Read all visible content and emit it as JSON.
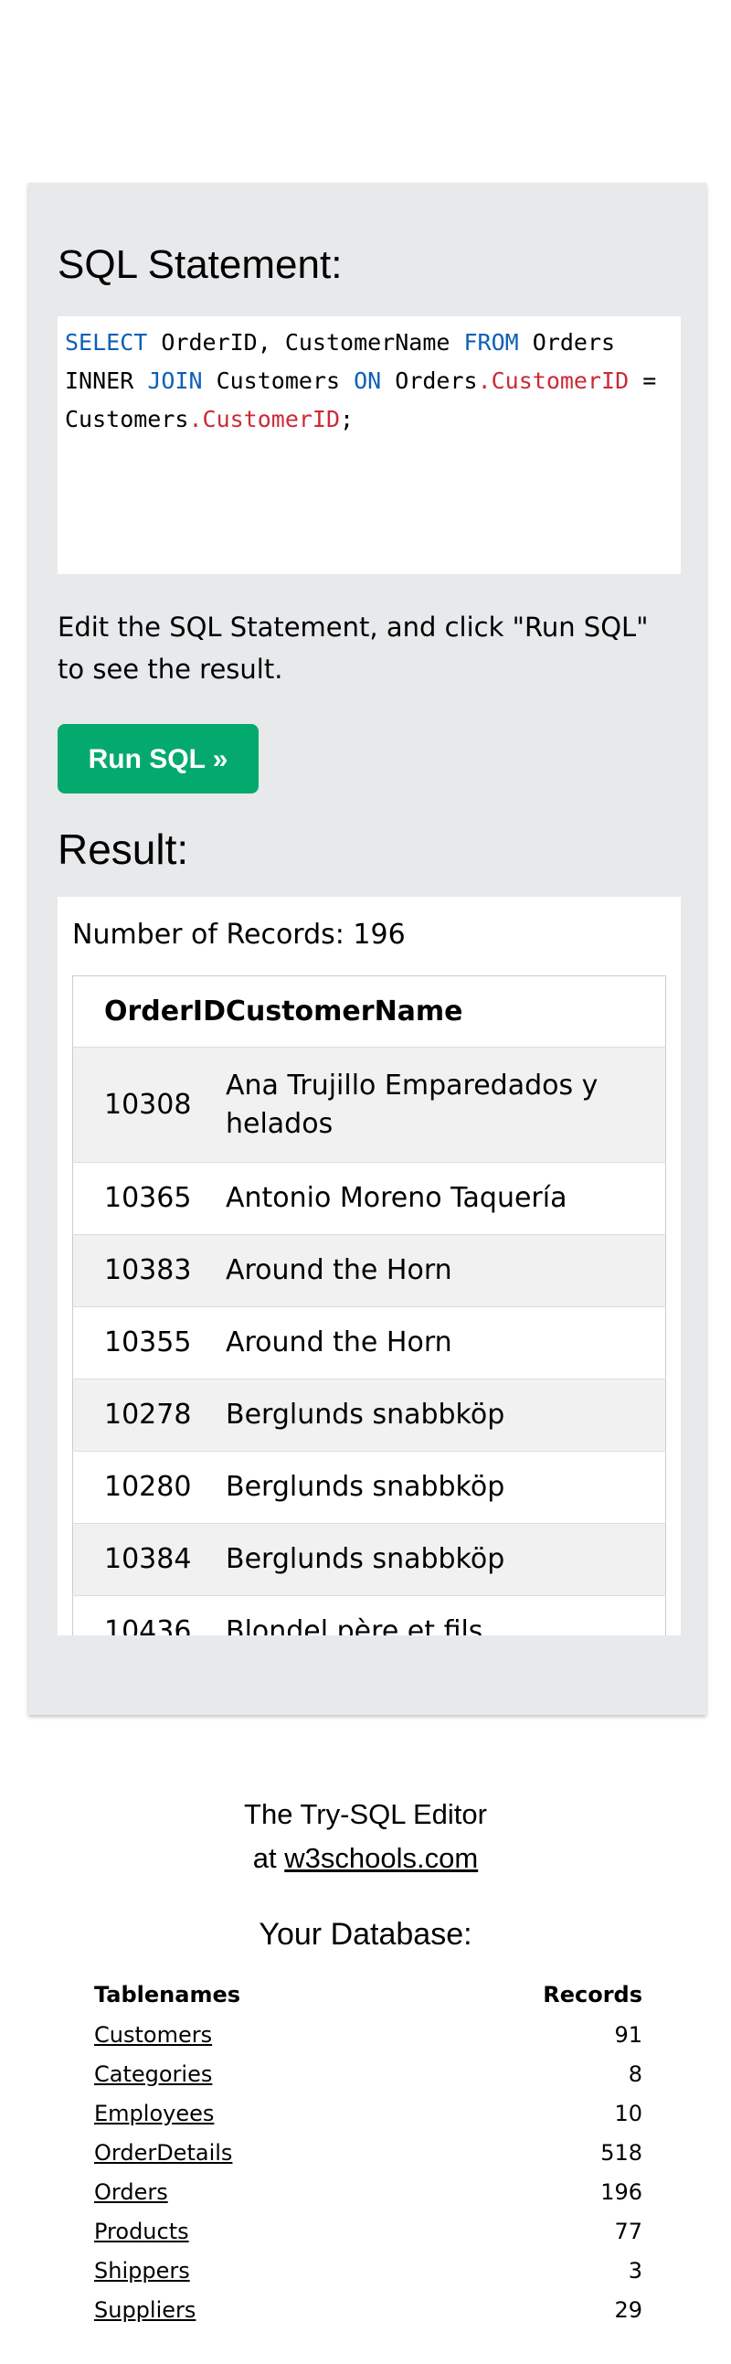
{
  "editor": {
    "heading": "SQL Statement:",
    "sql_tokens": [
      {
        "text": "SELECT",
        "type": "kw"
      },
      {
        "text": " OrderID, CustomerName ",
        "type": "plain"
      },
      {
        "text": "FROM",
        "type": "kw"
      },
      {
        "text": " Orders INNER ",
        "type": "plain"
      },
      {
        "text": "JOIN",
        "type": "kw"
      },
      {
        "text": " Customers ",
        "type": "plain"
      },
      {
        "text": "ON",
        "type": "kw"
      },
      {
        "text": " Orders",
        "type": "plain"
      },
      {
        "text": ".CustomerID",
        "type": "prop"
      },
      {
        "text": " = Customers",
        "type": "plain"
      },
      {
        "text": ".CustomerID",
        "type": "prop"
      },
      {
        "text": ";",
        "type": "plain"
      }
    ],
    "instructions": "Edit the SQL Statement, and click \"Run SQL\" to see the result.",
    "run_button_label": "Run SQL »",
    "colors": {
      "keyword": "#0d5fb8",
      "property": "#cc2a36",
      "run_button": "#04aa6d",
      "panel": "#e7e9eb"
    }
  },
  "result": {
    "heading": "Result:",
    "records_label": "Number of Records: 196",
    "columns": [
      "OrderID",
      "CustomerName"
    ],
    "rows": [
      {
        "order_id": "10308",
        "customer": "Ana Trujillo Emparedados y helados"
      },
      {
        "order_id": "10365",
        "customer": "Antonio Moreno Taquería"
      },
      {
        "order_id": "10383",
        "customer": "Around the Horn"
      },
      {
        "order_id": "10355",
        "customer": "Around the Horn"
      },
      {
        "order_id": "10278",
        "customer": "Berglunds snabbköp"
      },
      {
        "order_id": "10280",
        "customer": "Berglunds snabbköp"
      },
      {
        "order_id": "10384",
        "customer": "Berglunds snabbköp"
      },
      {
        "order_id": "10436",
        "customer": "Blondel père et fils"
      }
    ]
  },
  "footer": {
    "line1": "The Try-SQL Editor",
    "line2_prefix": "at ",
    "line2_link": "w3schools.com"
  },
  "database": {
    "heading": "Your Database:",
    "col_name": "Tablenames",
    "col_records": "Records",
    "tables": [
      {
        "name": "Customers",
        "records": "91"
      },
      {
        "name": "Categories",
        "records": "8"
      },
      {
        "name": "Employees",
        "records": "10"
      },
      {
        "name": "OrderDetails",
        "records": "518"
      },
      {
        "name": "Orders",
        "records": "196"
      },
      {
        "name": "Products",
        "records": "77"
      },
      {
        "name": "Shippers",
        "records": "3"
      },
      {
        "name": "Suppliers",
        "records": "29"
      }
    ]
  }
}
